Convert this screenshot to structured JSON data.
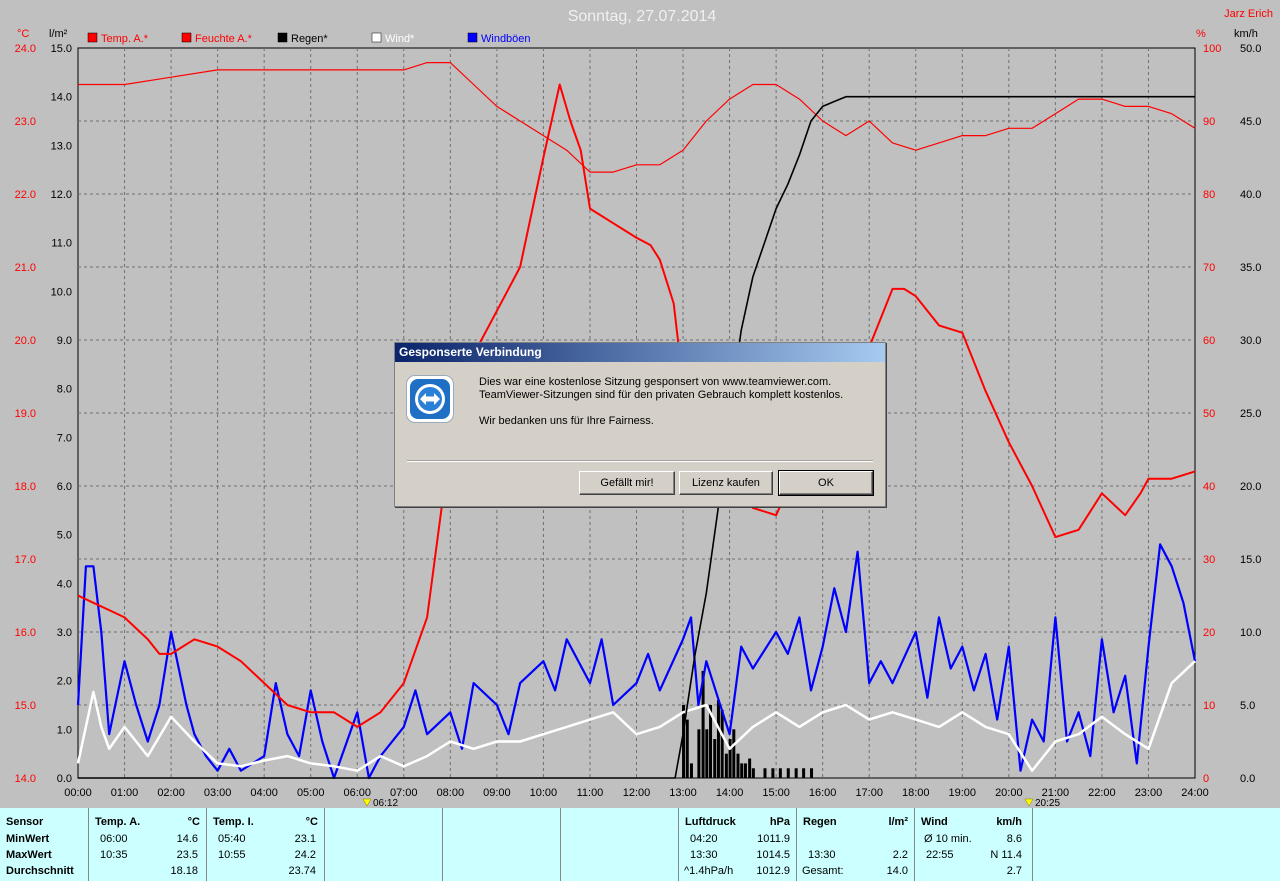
{
  "window": {
    "title": "Sonntag, 27.07.2014",
    "author": "Jarz Erich"
  },
  "colors": {
    "temp": "#ff0000",
    "humidity": "#ff0000",
    "rain": "#000000",
    "wind": "#ffffff",
    "gust": "#0000ff",
    "plot_bg": "#c0c0c0",
    "info_bg": "#ccffff",
    "marker": "#ffff00"
  },
  "axes_units": {
    "temp": "°C",
    "rain": "l/m²",
    "humidity": "%",
    "wind": "km/h"
  },
  "markers": {
    "sunrise": "06:12",
    "sunset": "20:25"
  },
  "info_panel": {
    "row_labels": [
      "Sensor",
      "MinWert",
      "MaxWert",
      "Durchschnitt"
    ],
    "temp_a": {
      "title": "Temp. A.",
      "unit": "°C",
      "min_time": "06:00",
      "min": "14.6",
      "max_time": "10:35",
      "max": "23.5",
      "avg": "18.18"
    },
    "temp_i": {
      "title": "Temp. I.",
      "unit": "°C",
      "min_time": "05:40",
      "min": "23.1",
      "max_time": "10:55",
      "max": "24.2",
      "avg": "23.74"
    },
    "pressure": {
      "title": "Luftdruck",
      "unit": "hPa",
      "min_time": "04:20",
      "min": "1011.9",
      "max_time": "13:30",
      "max": "1014.5",
      "trend": "^1.4hPa/h",
      "avg": "1012.9"
    },
    "rain": {
      "title": "Regen",
      "unit": "l/m²",
      "max_time": "13:30",
      "max": "2.2",
      "total_label": "Gesamt:",
      "total": "14.0"
    },
    "wind": {
      "title": "Wind",
      "unit": "km/h",
      "avg10_label": "Ø 10 min.",
      "avg10": "8.6",
      "max_time": "22:55",
      "max": "N 11.4",
      "avg": "2.7"
    }
  },
  "dialog": {
    "title": "Gesponserte Verbindung",
    "line1": "Dies war eine kostenlose Sitzung gesponsert von www.teamviewer.com.",
    "line2": "TeamViewer-Sitzungen sind für den privaten Gebrauch komplett kostenlos.",
    "line3": "Wir bedanken uns für Ihre Fairness.",
    "btn_like": "Gefällt mir!",
    "btn_license": "Lizenz kaufen",
    "btn_ok": "OK",
    "icon": "teamviewer-icon"
  },
  "chart_data": {
    "type": "line",
    "title": "Sonntag, 27.07.2014",
    "x_ticks": [
      "00:00",
      "01:00",
      "02:00",
      "03:00",
      "04:00",
      "05:00",
      "06:00",
      "07:00",
      "08:00",
      "09:00",
      "10:00",
      "11:00",
      "12:00",
      "13:00",
      "14:00",
      "15:00",
      "16:00",
      "17:00",
      "18:00",
      "19:00",
      "20:00",
      "21:00",
      "22:00",
      "23:00",
      "24:00"
    ],
    "xlim": [
      0,
      24
    ],
    "grid": true,
    "legend": [
      "Temp. A.*",
      "Feuchte A.*",
      "Regen*",
      "Wind*",
      "Windböen"
    ],
    "legend_placement": "top",
    "axes": {
      "temp": {
        "unit": "°C",
        "range": [
          14.0,
          24.0
        ],
        "ticks": [
          "14.0",
          "15.0",
          "16.0",
          "17.0",
          "18.0",
          "19.0",
          "20.0",
          "21.0",
          "22.0",
          "23.0",
          "24.0"
        ]
      },
      "rain": {
        "unit": "l/m²",
        "range": [
          0.0,
          15.0
        ],
        "ticks": [
          "0.0",
          "1.0",
          "2.0",
          "3.0",
          "4.0",
          "5.0",
          "6.0",
          "7.0",
          "8.0",
          "9.0",
          "10.0",
          "11.0",
          "12.0",
          "13.0",
          "14.0",
          "15.0"
        ]
      },
      "humidity": {
        "unit": "%",
        "range": [
          0,
          100
        ],
        "ticks": [
          "0",
          "10",
          "20",
          "30",
          "40",
          "50",
          "60",
          "70",
          "80",
          "90",
          "100"
        ]
      },
      "wind": {
        "unit": "km/h",
        "range": [
          0.0,
          50.0
        ],
        "ticks": [
          "0.0",
          "5.0",
          "10.0",
          "15.0",
          "20.0",
          "25.0",
          "30.0",
          "35.0",
          "40.0",
          "45.0",
          "50.0"
        ]
      }
    },
    "series": [
      {
        "name": "Temp. A.*",
        "axis": "temp",
        "x": [
          0,
          0.33,
          0.67,
          1,
          1.5,
          1.75,
          2,
          2.5,
          3,
          3.5,
          4,
          4.5,
          5,
          5.5,
          6,
          6.5,
          7,
          7.5,
          8,
          8.5,
          9,
          9.5,
          10,
          10.35,
          10.58,
          10.8,
          11,
          11.5,
          12,
          12.3,
          12.5,
          12.8,
          13,
          13.5,
          14,
          14.5,
          15,
          15.5,
          16,
          16.5,
          17,
          17.5,
          17.75,
          18,
          18.5,
          19,
          19.5,
          20,
          20.5,
          21,
          21.5,
          22,
          22.5,
          22.83,
          23,
          23.5,
          24
        ],
        "values": [
          16.5,
          16.4,
          16.3,
          16.2,
          15.9,
          15.7,
          15.7,
          15.9,
          15.8,
          15.6,
          15.3,
          15.0,
          14.9,
          14.9,
          14.7,
          14.9,
          15.3,
          16.2,
          18.6,
          19.8,
          20.4,
          21.0,
          22.5,
          23.5,
          23.0,
          22.6,
          21.8,
          21.6,
          21.4,
          21.3,
          21.1,
          20.5,
          19.4,
          18.6,
          18.4,
          17.7,
          17.6,
          18.3,
          18.8,
          19.5,
          19.9,
          20.7,
          20.7,
          20.6,
          20.2,
          20.1,
          19.3,
          18.6,
          18.0,
          17.3,
          17.4,
          17.9,
          17.6,
          17.9,
          18.1,
          18.1,
          18.2
        ]
      },
      {
        "name": "Feuchte A.*",
        "axis": "humidity",
        "x": [
          0,
          1,
          2,
          3,
          4,
          5,
          6,
          6.5,
          7,
          7.5,
          8,
          8.5,
          9,
          9.5,
          10,
          10.5,
          11,
          11.5,
          12,
          12.5,
          13,
          13.5,
          14,
          14.5,
          15,
          15.5,
          16,
          16.5,
          17,
          17.5,
          18,
          18.5,
          19,
          19.5,
          20,
          20.5,
          21,
          21.5,
          22,
          22.5,
          23,
          23.5,
          24
        ],
        "values": [
          95,
          95,
          96,
          97,
          97,
          97,
          97,
          97,
          97,
          98,
          98,
          95,
          92,
          90,
          88,
          86,
          83,
          83,
          84,
          84,
          86,
          90,
          93,
          95,
          95,
          93,
          90,
          88,
          90,
          87,
          86,
          87,
          88,
          88,
          89,
          89,
          91,
          93,
          93,
          92,
          92,
          91,
          89
        ]
      },
      {
        "name": "Regen*",
        "axis": "rain",
        "x": [
          0,
          12.83,
          13,
          13.25,
          13.5,
          13.75,
          14,
          14.25,
          14.5,
          14.75,
          15,
          15.25,
          15.5,
          15.75,
          16,
          16.25,
          16.5,
          17,
          24
        ],
        "values": [
          0.0,
          0.0,
          0.9,
          2.5,
          3.8,
          5.5,
          7.5,
          9.2,
          10.3,
          11.0,
          11.7,
          12.2,
          12.8,
          13.5,
          13.8,
          13.9,
          14.0,
          14.0,
          14.0
        ]
      },
      {
        "name": "Wind*",
        "axis": "wind",
        "x": [
          0,
          0.33,
          0.5,
          0.67,
          1,
          1.5,
          2,
          2.5,
          3,
          3.5,
          4,
          4.5,
          5,
          5.5,
          6,
          6.5,
          7,
          7.5,
          8,
          8.5,
          9,
          9.5,
          10,
          10.5,
          11,
          11.5,
          12,
          12.5,
          13,
          13.5,
          14,
          14.5,
          15,
          15.5,
          16,
          16.5,
          17,
          17.5,
          18,
          18.5,
          19,
          19.5,
          20,
          20.5,
          21,
          21.5,
          22,
          22.5,
          23,
          23.5,
          24
        ],
        "values": [
          1.0,
          5.9,
          3.5,
          2.0,
          3.5,
          1.5,
          4.2,
          2.5,
          1.0,
          0.8,
          1.2,
          1.5,
          1.0,
          0.8,
          0.5,
          1.5,
          0.8,
          1.5,
          2.5,
          2.0,
          2.5,
          2.5,
          3.0,
          3.5,
          4.0,
          4.5,
          3.0,
          3.5,
          4.5,
          5.0,
          2.0,
          3.5,
          4.5,
          3.5,
          4.5,
          5.0,
          4.0,
          4.5,
          4.0,
          3.5,
          4.5,
          3.5,
          3.0,
          0.5,
          2.5,
          3.0,
          4.2,
          3.0,
          2.0,
          6.5,
          8.0
        ]
      },
      {
        "name": "Windböen",
        "axis": "wind",
        "x": [
          0,
          0.17,
          0.33,
          0.5,
          0.67,
          1,
          1.25,
          1.5,
          1.75,
          2,
          2.33,
          2.5,
          2.75,
          3,
          3.25,
          3.5,
          4,
          4.25,
          4.5,
          4.75,
          5,
          5.25,
          5.5,
          6,
          6.25,
          6.5,
          7,
          7.25,
          7.5,
          8,
          8.25,
          8.5,
          9,
          9.25,
          9.5,
          10,
          10.25,
          10.5,
          11,
          11.25,
          11.5,
          12,
          12.25,
          12.5,
          13,
          13.17,
          13.33,
          13.5,
          13.75,
          14,
          14.25,
          14.5,
          15,
          15.25,
          15.5,
          15.75,
          16,
          16.25,
          16.5,
          16.75,
          17,
          17.25,
          17.5,
          18,
          18.25,
          18.5,
          18.75,
          19,
          19.25,
          19.5,
          19.75,
          20,
          20.25,
          20.5,
          20.75,
          21,
          21.25,
          21.5,
          21.75,
          22,
          22.25,
          22.5,
          22.75,
          23,
          23.25,
          23.5,
          23.75,
          24
        ],
        "values": [
          5.0,
          14.5,
          14.5,
          10.0,
          3.0,
          8.0,
          5.0,
          2.5,
          5.0,
          10.0,
          5.0,
          3.0,
          1.5,
          0.5,
          2.0,
          0.5,
          1.5,
          6.5,
          3.0,
          1.5,
          6.0,
          2.5,
          0.0,
          4.5,
          0.0,
          1.5,
          3.5,
          6.0,
          3.0,
          4.5,
          2.0,
          6.5,
          5.0,
          3.0,
          6.5,
          8.0,
          6.0,
          9.5,
          6.5,
          9.5,
          5.0,
          6.5,
          8.5,
          6.0,
          9.5,
          11.0,
          5.0,
          8.0,
          5.5,
          3.0,
          9.0,
          7.5,
          10.0,
          8.5,
          11.0,
          6.0,
          9.0,
          13.0,
          10.0,
          15.5,
          6.5,
          8.0,
          6.5,
          10.0,
          5.5,
          11.0,
          7.5,
          9.0,
          6.0,
          8.5,
          4.0,
          9.0,
          0.5,
          4.0,
          2.5,
          11.0,
          2.5,
          4.5,
          1.5,
          9.5,
          4.5,
          7.0,
          1.0,
          9.0,
          16.0,
          14.5,
          12.0,
          8.0
        ]
      }
    ],
    "rain_bars": {
      "axis": "rain",
      "x": [
        13.0,
        13.08,
        13.17,
        13.33,
        13.42,
        13.5,
        13.58,
        13.67,
        13.75,
        13.83,
        13.92,
        14.0,
        14.08,
        14.17,
        14.25,
        14.33,
        14.42,
        14.5,
        14.75,
        14.92,
        15.08,
        15.25,
        15.42,
        15.58,
        15.75
      ],
      "values": [
        1.5,
        1.2,
        0.3,
        1.0,
        2.2,
        1.0,
        1.5,
        0.8,
        1.6,
        1.4,
        0.5,
        0.8,
        1.0,
        0.5,
        0.3,
        0.3,
        0.4,
        0.2,
        0.2,
        0.2,
        0.2,
        0.2,
        0.2,
        0.2,
        0.2
      ]
    }
  }
}
